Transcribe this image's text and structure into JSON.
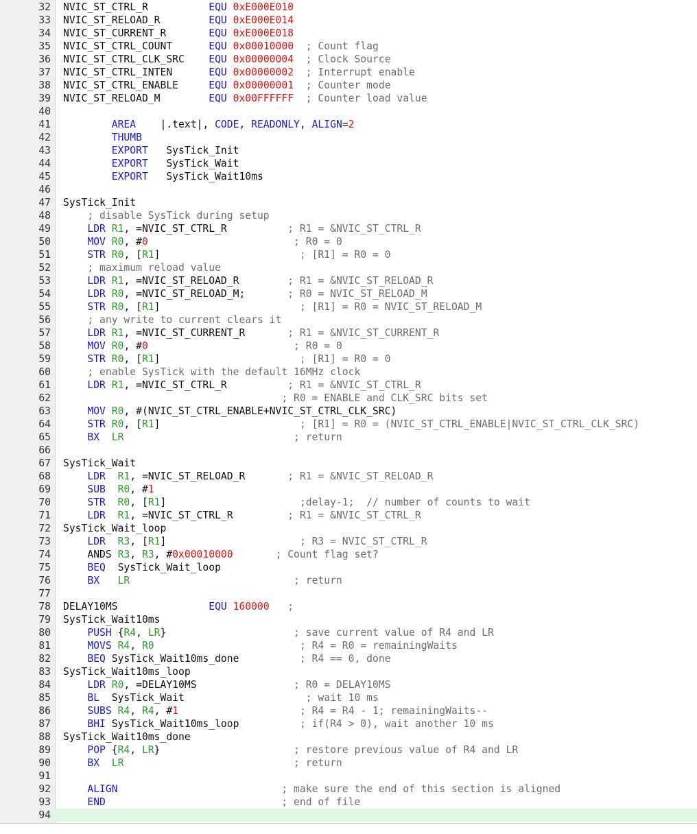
{
  "editor": {
    "first_line": 32,
    "current_line": 94,
    "colors": {
      "keyword": "#1a1ad0",
      "number": "#dd1111",
      "register": "#2e9a2e",
      "comment": "#6e6e6e",
      "text": "#111111",
      "gutter_bg": "#eeeeee",
      "current_line_bg": "#dff6e2"
    },
    "lines": [
      [
        [
          "t",
          "NVIC_ST_CTRL_R          "
        ],
        [
          "k",
          "EQU"
        ],
        [
          "t",
          " "
        ],
        [
          "n",
          "0xE000E010"
        ]
      ],
      [
        [
          "t",
          "NVIC_ST_RELOAD_R        "
        ],
        [
          "k",
          "EQU"
        ],
        [
          "t",
          " "
        ],
        [
          "n",
          "0xE000E014"
        ]
      ],
      [
        [
          "t",
          "NVIC_ST_CURRENT_R       "
        ],
        [
          "k",
          "EQU"
        ],
        [
          "t",
          " "
        ],
        [
          "n",
          "0xE000E018"
        ]
      ],
      [
        [
          "t",
          "NVIC_ST_CTRL_COUNT      "
        ],
        [
          "k",
          "EQU"
        ],
        [
          "t",
          " "
        ],
        [
          "n",
          "0x00010000"
        ],
        [
          "t",
          "  "
        ],
        [
          "c",
          "; Count flag"
        ]
      ],
      [
        [
          "t",
          "NVIC_ST_CTRL_CLK_SRC    "
        ],
        [
          "k",
          "EQU"
        ],
        [
          "t",
          " "
        ],
        [
          "n",
          "0x00000004"
        ],
        [
          "t",
          "  "
        ],
        [
          "c",
          "; Clock Source"
        ]
      ],
      [
        [
          "t",
          "NVIC_ST_CTRL_INTEN      "
        ],
        [
          "k",
          "EQU"
        ],
        [
          "t",
          " "
        ],
        [
          "n",
          "0x00000002"
        ],
        [
          "t",
          "  "
        ],
        [
          "c",
          "; Interrupt enable"
        ]
      ],
      [
        [
          "t",
          "NVIC_ST_CTRL_ENABLE     "
        ],
        [
          "k",
          "EQU"
        ],
        [
          "t",
          " "
        ],
        [
          "n",
          "0x00000001"
        ],
        [
          "t",
          "  "
        ],
        [
          "c",
          "; Counter mode"
        ]
      ],
      [
        [
          "t",
          "NVIC_ST_RELOAD_M        "
        ],
        [
          "k",
          "EQU"
        ],
        [
          "t",
          " "
        ],
        [
          "n",
          "0x00FFFFFF"
        ],
        [
          "t",
          "  "
        ],
        [
          "c",
          "; Counter load value"
        ]
      ],
      [],
      [
        [
          "t",
          "        "
        ],
        [
          "k",
          "AREA"
        ],
        [
          "t",
          "    |.text|, "
        ],
        [
          "k",
          "CODE"
        ],
        [
          "t",
          ", "
        ],
        [
          "k",
          "READONLY"
        ],
        [
          "t",
          ", "
        ],
        [
          "k",
          "ALIGN"
        ],
        [
          "t",
          "="
        ],
        [
          "n",
          "2"
        ]
      ],
      [
        [
          "t",
          "        "
        ],
        [
          "k",
          "THUMB"
        ]
      ],
      [
        [
          "t",
          "        "
        ],
        [
          "k",
          "EXPORT"
        ],
        [
          "t",
          "   SysTick_Init"
        ]
      ],
      [
        [
          "t",
          "        "
        ],
        [
          "k",
          "EXPORT"
        ],
        [
          "t",
          "   SysTick_Wait"
        ]
      ],
      [
        [
          "t",
          "        "
        ],
        [
          "k",
          "EXPORT"
        ],
        [
          "t",
          "   SysTick_Wait10ms"
        ]
      ],
      [],
      [
        [
          "t",
          "SysTick_Init"
        ]
      ],
      [
        [
          "t",
          "    "
        ],
        [
          "c",
          "; disable SysTick during setup"
        ]
      ],
      [
        [
          "t",
          "    "
        ],
        [
          "k",
          "LDR"
        ],
        [
          "t",
          " "
        ],
        [
          "r",
          "R1"
        ],
        [
          "t",
          ", =NVIC_ST_CTRL_R          "
        ],
        [
          "c",
          "; R1 = &NVIC_ST_CTRL_R"
        ]
      ],
      [
        [
          "t",
          "    "
        ],
        [
          "k",
          "MOV"
        ],
        [
          "t",
          " "
        ],
        [
          "r",
          "R0"
        ],
        [
          "t",
          ", #"
        ],
        [
          "n",
          "0"
        ],
        [
          "t",
          "                        "
        ],
        [
          "c",
          "; R0 = 0"
        ]
      ],
      [
        [
          "t",
          "    "
        ],
        [
          "k",
          "STR"
        ],
        [
          "t",
          " "
        ],
        [
          "r",
          "R0"
        ],
        [
          "t",
          ", ["
        ],
        [
          "r",
          "R1"
        ],
        [
          "t",
          "]                       "
        ],
        [
          "c",
          "; [R1] = R0 = 0"
        ]
      ],
      [
        [
          "t",
          "    "
        ],
        [
          "c",
          "; maximum reload value"
        ]
      ],
      [
        [
          "t",
          "    "
        ],
        [
          "k",
          "LDR"
        ],
        [
          "t",
          " "
        ],
        [
          "r",
          "R1"
        ],
        [
          "t",
          ", =NVIC_ST_RELOAD_R        "
        ],
        [
          "c",
          "; R1 = &NVIC_ST_RELOAD_R"
        ]
      ],
      [
        [
          "t",
          "    "
        ],
        [
          "k",
          "LDR"
        ],
        [
          "t",
          " "
        ],
        [
          "r",
          "R0"
        ],
        [
          "t",
          ", =NVIC_ST_RELOAD_M;       "
        ],
        [
          "c",
          "; R0 = NVIC_ST_RELOAD_M"
        ]
      ],
      [
        [
          "t",
          "    "
        ],
        [
          "k",
          "STR"
        ],
        [
          "t",
          " "
        ],
        [
          "r",
          "R0"
        ],
        [
          "t",
          ", ["
        ],
        [
          "r",
          "R1"
        ],
        [
          "t",
          "]                       "
        ],
        [
          "c",
          "; [R1] = R0 = NVIC_ST_RELOAD_M"
        ]
      ],
      [
        [
          "t",
          "    "
        ],
        [
          "c",
          "; any write to current clears it"
        ]
      ],
      [
        [
          "t",
          "    "
        ],
        [
          "k",
          "LDR"
        ],
        [
          "t",
          " "
        ],
        [
          "r",
          "R1"
        ],
        [
          "t",
          ", =NVIC_ST_CURRENT_R       "
        ],
        [
          "c",
          "; R1 = &NVIC_ST_CURRENT_R"
        ]
      ],
      [
        [
          "t",
          "    "
        ],
        [
          "k",
          "MOV"
        ],
        [
          "t",
          " "
        ],
        [
          "r",
          "R0"
        ],
        [
          "t",
          ", #"
        ],
        [
          "n",
          "0"
        ],
        [
          "t",
          "                        "
        ],
        [
          "c",
          "; R0 = 0"
        ]
      ],
      [
        [
          "t",
          "    "
        ],
        [
          "k",
          "STR"
        ],
        [
          "t",
          " "
        ],
        [
          "r",
          "R0"
        ],
        [
          "t",
          ", ["
        ],
        [
          "r",
          "R1"
        ],
        [
          "t",
          "]                       "
        ],
        [
          "c",
          "; [R1] = R0 = 0"
        ]
      ],
      [
        [
          "t",
          "    "
        ],
        [
          "c",
          "; enable SysTick with the default 16MHz clock"
        ]
      ],
      [
        [
          "t",
          "    "
        ],
        [
          "k",
          "LDR"
        ],
        [
          "t",
          " "
        ],
        [
          "r",
          "R1"
        ],
        [
          "t",
          ", =NVIC_ST_CTRL_R          "
        ],
        [
          "c",
          "; R1 = &NVIC_ST_CTRL_R"
        ]
      ],
      [
        [
          "t",
          "                                    "
        ],
        [
          "c",
          "; R0 = ENABLE and CLK_SRC bits set"
        ]
      ],
      [
        [
          "t",
          "    "
        ],
        [
          "k",
          "MOV"
        ],
        [
          "t",
          " "
        ],
        [
          "r",
          "R0"
        ],
        [
          "t",
          ", #(NVIC_ST_CTRL_ENABLE+NVIC_ST_CTRL_CLK_SRC)"
        ]
      ],
      [
        [
          "t",
          "    "
        ],
        [
          "k",
          "STR"
        ],
        [
          "t",
          " "
        ],
        [
          "r",
          "R0"
        ],
        [
          "t",
          ", ["
        ],
        [
          "r",
          "R1"
        ],
        [
          "t",
          "]                       "
        ],
        [
          "c",
          "; [R1] = R0 = (NVIC_ST_CTRL_ENABLE|NVIC_ST_CTRL_CLK_SRC)"
        ]
      ],
      [
        [
          "t",
          "    "
        ],
        [
          "k",
          "BX"
        ],
        [
          "t",
          "  "
        ],
        [
          "r",
          "LR"
        ],
        [
          "t",
          "                            "
        ],
        [
          "c",
          "; return"
        ]
      ],
      [],
      [
        [
          "t",
          "SysTick_Wait"
        ]
      ],
      [
        [
          "t",
          "    "
        ],
        [
          "k",
          "LDR"
        ],
        [
          "t",
          "  "
        ],
        [
          "r",
          "R1"
        ],
        [
          "t",
          ", =NVIC_ST_RELOAD_R       "
        ],
        [
          "c",
          "; R1 = &NVIC_ST_RELOAD_R"
        ]
      ],
      [
        [
          "t",
          "    "
        ],
        [
          "k",
          "SUB"
        ],
        [
          "t",
          "  "
        ],
        [
          "r",
          "R0"
        ],
        [
          "t",
          ", #"
        ],
        [
          "n",
          "1"
        ]
      ],
      [
        [
          "t",
          "    "
        ],
        [
          "k",
          "STR"
        ],
        [
          "t",
          "  "
        ],
        [
          "r",
          "R0"
        ],
        [
          "t",
          ", ["
        ],
        [
          "r",
          "R1"
        ],
        [
          "t",
          "]                      "
        ],
        [
          "c",
          ";delay-1;  // number of counts to wait"
        ]
      ],
      [
        [
          "t",
          "    "
        ],
        [
          "k",
          "LDR"
        ],
        [
          "t",
          "  "
        ],
        [
          "r",
          "R1"
        ],
        [
          "t",
          ", =NVIC_ST_CTRL_R         "
        ],
        [
          "c",
          "; R1 = &NVIC_ST_CTRL_R"
        ]
      ],
      [
        [
          "t",
          "SysTick_Wait_loop"
        ]
      ],
      [
        [
          "t",
          "    "
        ],
        [
          "k",
          "LDR"
        ],
        [
          "t",
          "  "
        ],
        [
          "r",
          "R3"
        ],
        [
          "t",
          ", ["
        ],
        [
          "r",
          "R1"
        ],
        [
          "t",
          "]                      "
        ],
        [
          "c",
          "; R3 = NVIC_ST_CTRL_R"
        ]
      ],
      [
        [
          "t",
          "    ANDS "
        ],
        [
          "r",
          "R3"
        ],
        [
          "t",
          ", "
        ],
        [
          "r",
          "R3"
        ],
        [
          "t",
          ", #"
        ],
        [
          "n",
          "0x00010000"
        ],
        [
          "t",
          "       "
        ],
        [
          "c",
          "; Count flag set?"
        ]
      ],
      [
        [
          "t",
          "    "
        ],
        [
          "k",
          "BEQ"
        ],
        [
          "t",
          "  SysTick_Wait_loop"
        ]
      ],
      [
        [
          "t",
          "    "
        ],
        [
          "k",
          "BX"
        ],
        [
          "t",
          "   "
        ],
        [
          "r",
          "LR"
        ],
        [
          "t",
          "                           "
        ],
        [
          "c",
          "; return"
        ]
      ],
      [],
      [
        [
          "t",
          "DELAY10MS               "
        ],
        [
          "k",
          "EQU"
        ],
        [
          "t",
          " "
        ],
        [
          "n",
          "160000"
        ],
        [
          "t",
          "   "
        ],
        [
          "c",
          ";"
        ]
      ],
      [
        [
          "t",
          "SysTick_Wait10ms"
        ]
      ],
      [
        [
          "t",
          "    "
        ],
        [
          "k",
          "PUSH"
        ],
        [
          "t",
          " {"
        ],
        [
          "r",
          "R4"
        ],
        [
          "t",
          ", "
        ],
        [
          "r",
          "LR"
        ],
        [
          "t",
          "}                     "
        ],
        [
          "c",
          "; save current value of R4 and LR"
        ]
      ],
      [
        [
          "t",
          "    "
        ],
        [
          "k",
          "MOVS"
        ],
        [
          "t",
          " "
        ],
        [
          "r",
          "R4"
        ],
        [
          "t",
          ", "
        ],
        [
          "r",
          "R0"
        ],
        [
          "t",
          "                        "
        ],
        [
          "c",
          "; R4 = R0 = remainingWaits"
        ]
      ],
      [
        [
          "t",
          "    "
        ],
        [
          "k",
          "BEQ"
        ],
        [
          "t",
          " SysTick_Wait10ms_done          "
        ],
        [
          "c",
          "; R4 == 0, done"
        ]
      ],
      [
        [
          "t",
          "SysTick_Wait10ms_loop"
        ]
      ],
      [
        [
          "t",
          "    "
        ],
        [
          "k",
          "LDR"
        ],
        [
          "t",
          " "
        ],
        [
          "r",
          "R0"
        ],
        [
          "t",
          ", =DELAY10MS                "
        ],
        [
          "c",
          "; R0 = DELAY10MS"
        ]
      ],
      [
        [
          "t",
          "    "
        ],
        [
          "k",
          "BL"
        ],
        [
          "t",
          "  SysTick_Wait                    "
        ],
        [
          "c",
          "; wait 10 ms"
        ]
      ],
      [
        [
          "t",
          "    "
        ],
        [
          "k",
          "SUBS"
        ],
        [
          "t",
          " "
        ],
        [
          "r",
          "R4"
        ],
        [
          "t",
          ", "
        ],
        [
          "r",
          "R4"
        ],
        [
          "t",
          ", #"
        ],
        [
          "n",
          "1"
        ],
        [
          "t",
          "                    "
        ],
        [
          "c",
          "; R4 = R4 - 1; remainingWaits--"
        ]
      ],
      [
        [
          "t",
          "    "
        ],
        [
          "k",
          "BHI"
        ],
        [
          "t",
          " SysTick_Wait10ms_loop          "
        ],
        [
          "c",
          "; if(R4 > 0), wait another 10 ms"
        ]
      ],
      [
        [
          "t",
          "SysTick_Wait10ms_done"
        ]
      ],
      [
        [
          "t",
          "    "
        ],
        [
          "k",
          "POP"
        ],
        [
          "t",
          " {"
        ],
        [
          "r",
          "R4"
        ],
        [
          "t",
          ", "
        ],
        [
          "r",
          "LR"
        ],
        [
          "t",
          "}                      "
        ],
        [
          "c",
          "; restore previous value of R4 and LR"
        ]
      ],
      [
        [
          "t",
          "    "
        ],
        [
          "k",
          "BX"
        ],
        [
          "t",
          "  "
        ],
        [
          "r",
          "LR"
        ],
        [
          "t",
          "                            "
        ],
        [
          "c",
          "; return"
        ]
      ],
      [],
      [
        [
          "t",
          "    "
        ],
        [
          "k",
          "ALIGN"
        ],
        [
          "t",
          "                           "
        ],
        [
          "c",
          "; make sure the end of this section is aligned"
        ]
      ],
      [
        [
          "t",
          "    "
        ],
        [
          "k",
          "END"
        ],
        [
          "t",
          "                             "
        ],
        [
          "c",
          "; end of file"
        ]
      ],
      []
    ]
  }
}
